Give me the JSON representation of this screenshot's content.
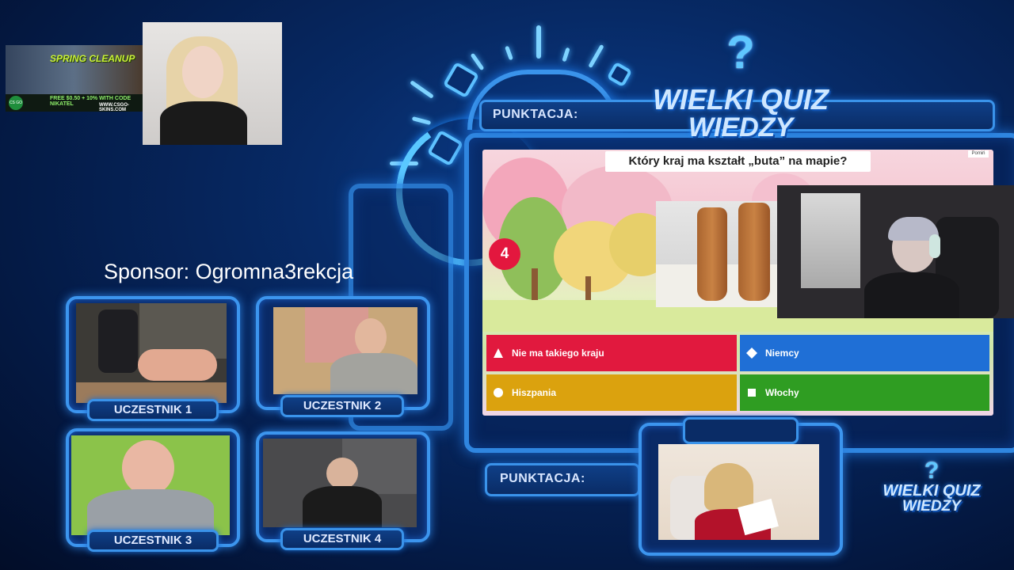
{
  "sponsor": "Sponsor: Ogromna3rekcja",
  "score_label_top": "PUNKTACJA:",
  "score_label_bottom": "PUNKTACJA:",
  "logo": {
    "q": "?",
    "line1": "WIELKI QUIZ",
    "line2": "WIEDZY"
  },
  "quiz": {
    "question": "Który kraj ma kształt „buta” na mapie?",
    "skip_label": "Pomiń",
    "timer": "4",
    "answers": [
      {
        "label": "Nie ma takiego kraju",
        "color": "#e1193e",
        "shape": "triangle"
      },
      {
        "label": "Niemcy",
        "color": "#1f6fd6",
        "shape": "diamond"
      },
      {
        "label": "Hiszpania",
        "color": "#dba20e",
        "shape": "circle"
      },
      {
        "label": "Włochy",
        "color": "#2f9d22",
        "shape": "square"
      }
    ]
  },
  "participants": [
    {
      "name": "UCZESTNIK 1"
    },
    {
      "name": "UCZESTNIK 2"
    },
    {
      "name": "UCZESTNIK 3"
    },
    {
      "name": "UCZESTNIK 4"
    }
  ],
  "ad": {
    "title": "SPRING CLEANUP",
    "promo": "FREE $0.50 + 10% WITH CODE NIKATEL",
    "site": "WWW.CSGO-SKINS.COM",
    "badge": "CS GO"
  },
  "colors": {
    "accent": "#3a93ea",
    "background": "#072a66"
  }
}
